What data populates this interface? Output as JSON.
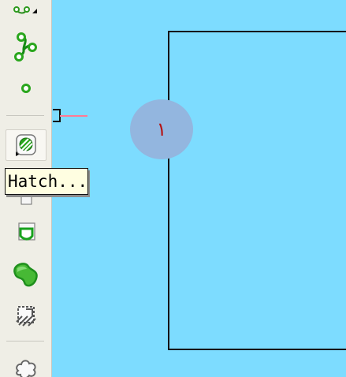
{
  "toolbar": {
    "tools": [
      {
        "name": "pline-edit-icon"
      },
      {
        "name": "spline-icon"
      },
      {
        "name": "point-icon"
      },
      {
        "name": "hatch-icon"
      },
      {
        "name": "gradient-icon"
      },
      {
        "name": "boundary-icon"
      },
      {
        "name": "region-icon"
      },
      {
        "name": "wipeout-icon"
      },
      {
        "name": "revision-cloud-icon"
      }
    ]
  },
  "tooltip": {
    "label": "Hatch..."
  },
  "annotation": {
    "step_number": "١"
  },
  "colors": {
    "canvas": "#7ddcff",
    "toolbar": "#efeee6",
    "tooltip": "#fffee1",
    "marker_circle": "#93b6df",
    "marker_text": "#b61212",
    "marker_line": "#ff7a95",
    "icon_green": "#31a51c"
  }
}
